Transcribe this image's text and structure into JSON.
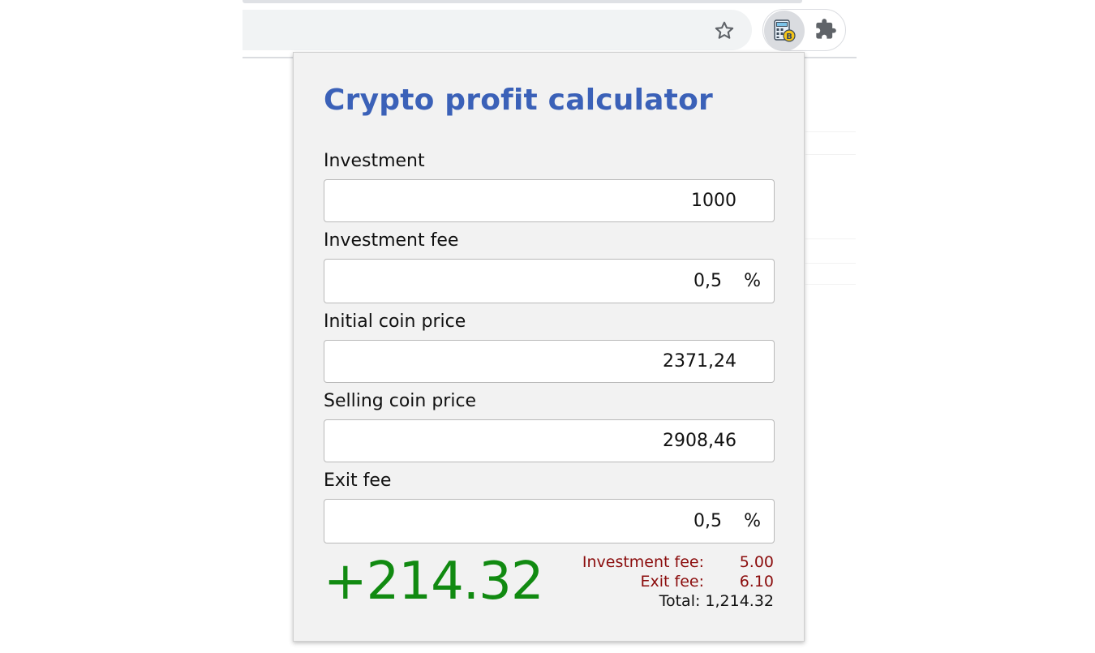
{
  "browser": {
    "icons": {
      "bookmark": "star-outline",
      "extension": "calculator-bitcoin",
      "extensions_menu": "puzzle-piece"
    }
  },
  "popup": {
    "title": "Crypto profit calculator",
    "fields": [
      {
        "label": "Investment",
        "value": "1000",
        "suffix": ""
      },
      {
        "label": "Investment fee",
        "value": "0,5",
        "suffix": "%"
      },
      {
        "label": "Initial coin price",
        "value": "2371,24",
        "suffix": ""
      },
      {
        "label": "Selling coin price",
        "value": "2908,46",
        "suffix": ""
      },
      {
        "label": "Exit fee",
        "value": "0,5",
        "suffix": "%"
      }
    ],
    "result": {
      "profit": "+214.32",
      "investment_fee_label": "Investment fee:",
      "investment_fee_value": "5.00",
      "exit_fee_label": "Exit fee:",
      "exit_fee_value": "6.10",
      "total_label": "Total:",
      "total_value": "1,214.32"
    },
    "colors": {
      "title": "#3b61b8",
      "profit": "#118a11",
      "fee": "#8b0c0c"
    }
  }
}
